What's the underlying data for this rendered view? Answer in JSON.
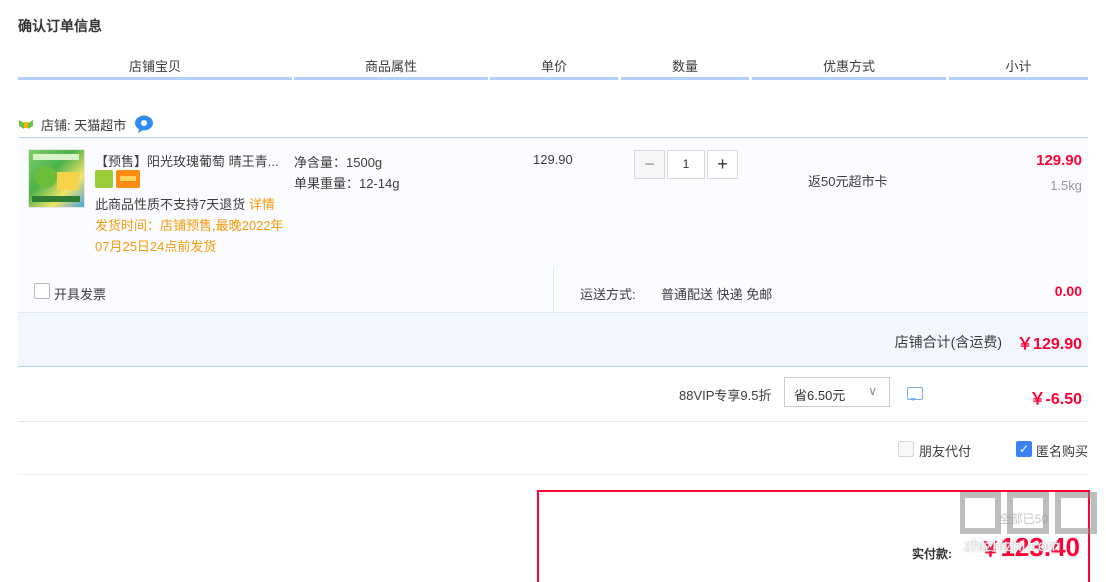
{
  "page": {
    "title": "确认订单信息"
  },
  "columns": [
    "店铺宝贝",
    "商品属性",
    "单价",
    "数量",
    "优惠方式",
    "小计"
  ],
  "shop": {
    "label": "店铺: 天猫超市"
  },
  "item": {
    "title": "【预售】阳光玫瑰葡萄 晴王青...",
    "no_return": "此商品性质不支持7天退货",
    "detail_link": "详情",
    "ship_note": "发货时间：店铺预售,最晚2022年07月25日24点前发货",
    "props": [
      "净含量：1500g",
      "单果重量：12-14g"
    ],
    "unit_price": "129.90",
    "quantity": "1",
    "promo": "返50元超市卡",
    "subtotal": "129.90",
    "weight": "1.5kg"
  },
  "invoice": {
    "label": "开具发票"
  },
  "delivery": {
    "label": "运送方式:",
    "value": "普通配送 快递 免邮",
    "fee": "0.00"
  },
  "shop_total": {
    "label": "店铺合计(含运费)",
    "value": "￥129.90"
  },
  "vip": {
    "label": "88VIP专享9.5折",
    "selected": "省6.50元",
    "value": "￥-6.50"
  },
  "options": {
    "friend_pay": "朋友代付",
    "anonymous": "匿名购买"
  },
  "payment": {
    "hint": "全部已50",
    "label": "实付款:",
    "currency": "￥",
    "value": "123.40"
  },
  "watermark": {
    "text": "zhizhizhi.com"
  },
  "colors": {
    "accent_red": "#ff0036",
    "header_line": "#b2d1ff",
    "orange_note": "#f59a0c"
  }
}
